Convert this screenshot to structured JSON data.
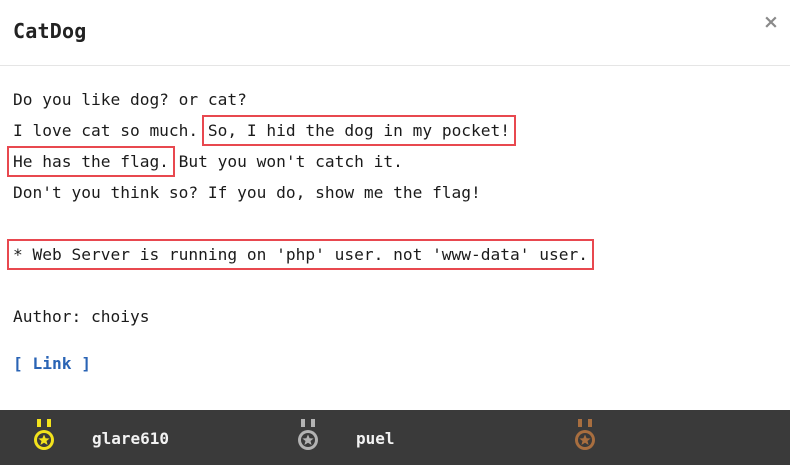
{
  "modal": {
    "title": "CatDog",
    "close_label": "×"
  },
  "description": {
    "line1": "Do you like dog? or cat?",
    "line2_a": "I love cat so much. ",
    "line2_b": "So, I hid the dog in my pocket!",
    "line3_a": "He has the flag.",
    "line3_b": " But you won't catch it.",
    "line4": "Don't you think so? If you do, show me the flag!",
    "line5": "* Web Server is running on 'php' user. not 'www-data' user.",
    "author": "Author: choiys",
    "link_label": "[ Link ]"
  },
  "solvers": [
    {
      "name": "glare610",
      "medal": "gold-medal-icon",
      "color": "#f2e21c"
    },
    {
      "name": "puel",
      "medal": "silver-medal-icon",
      "color": "#b3b3b3"
    },
    {
      "name": "",
      "medal": "bronze-medal-icon",
      "color": "#a86e3f"
    }
  ],
  "colors": {
    "highlight_box": "#e8484f",
    "link": "#2a64b5",
    "footer_bg": "#3a3a3a"
  }
}
